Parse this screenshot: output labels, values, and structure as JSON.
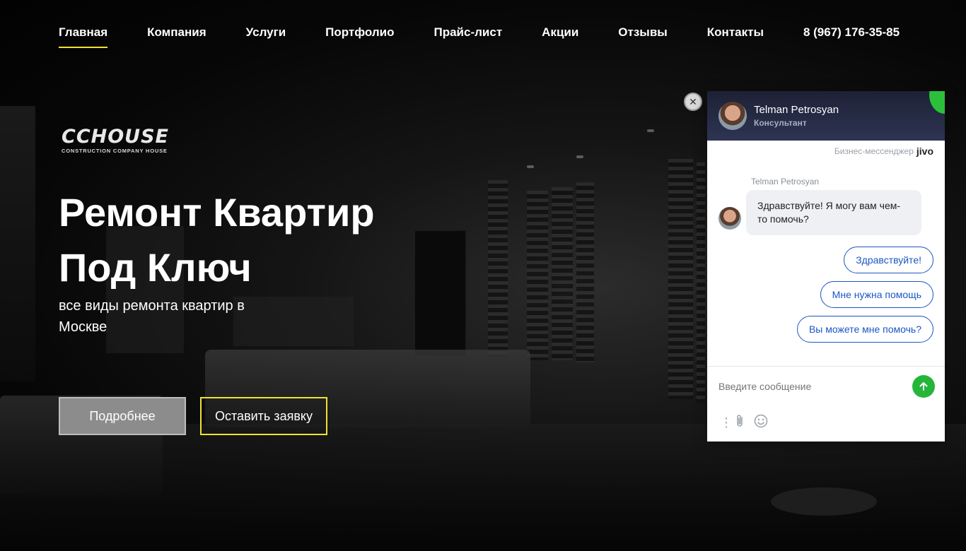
{
  "nav": {
    "items": [
      {
        "label": "Главная",
        "active": true
      },
      {
        "label": "Компания",
        "active": false
      },
      {
        "label": "Услуги",
        "active": false
      },
      {
        "label": "Портфолио",
        "active": false
      },
      {
        "label": "Прайс-лист",
        "active": false
      },
      {
        "label": "Акции",
        "active": false
      },
      {
        "label": "Отзывы",
        "active": false
      },
      {
        "label": "Контакты",
        "active": false
      }
    ],
    "phone": "8 (967) 176-35-85",
    "accent_color": "#f0e22d"
  },
  "logo": {
    "main": "CCHOUSE",
    "sub": "CONSTRUCTION COMPANY HOUSE"
  },
  "hero": {
    "title_line1": "Ремонт Квартир",
    "title_line2": "Под Ключ",
    "subtitle_line1": "все виды ремонта квартир в",
    "subtitle_line2": "Москве",
    "btn_more": "Подробнее",
    "btn_request": "Оставить заявку"
  },
  "chat": {
    "agent_name": "Telman Petrosyan",
    "agent_role": "Консультант",
    "powered_by": "Бизнес-мессенджер",
    "brand": "jivo",
    "message_author": "Telman Petrosyan",
    "message_text": "Здравствуйте! Я могу вам чем-то помочь?",
    "quick_replies": [
      "Здравствуйте!",
      "Мне нужна помощь",
      "Вы можете мне помочь?"
    ],
    "input_placeholder": "Введите сообщение",
    "send_color": "#25b53a",
    "reply_color": "#1b56c4"
  }
}
